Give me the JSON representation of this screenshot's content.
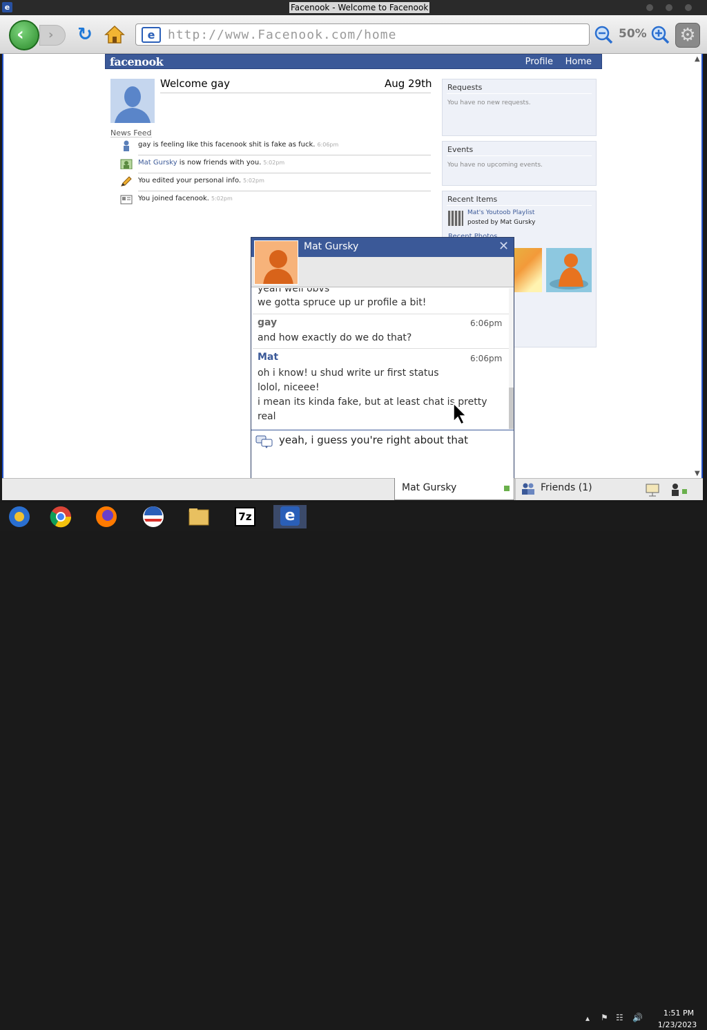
{
  "window": {
    "title": "Facenook - Welcome to Facenook"
  },
  "browser": {
    "url": "http://www.Facenook.com/home",
    "zoom": "50%"
  },
  "site": {
    "logo": "facenook",
    "nav": {
      "profile": "Profile",
      "home": "Home"
    },
    "welcome": "Welcome gay",
    "date": "Aug 29th",
    "newsfeed_label": "News Feed",
    "feed": [
      {
        "icon": "person-icon",
        "text": "gay is feeling like this facenook shit is fake as fuck.",
        "link": "",
        "time": "6:06pm"
      },
      {
        "icon": "friends-icon",
        "text": " is now friends with you.",
        "link": "Mat Gursky",
        "time": "5:02pm"
      },
      {
        "icon": "pencil-icon",
        "text": "You edited your personal info.",
        "link": "",
        "time": "5:02pm"
      },
      {
        "icon": "profile-card-icon",
        "text": "You joined facenook.",
        "link": "",
        "time": "5:02pm"
      }
    ],
    "requests": {
      "title": "Requests",
      "text": "You have no new requests."
    },
    "events": {
      "title": "Events",
      "text": "You have no upcoming events."
    },
    "recent": {
      "title": "Recent Items",
      "playlist": "Mat's Youtoob Playlist",
      "posted_by": "posted by Mat Gursky",
      "photos_label": "Recent Photos"
    }
  },
  "chat": {
    "name": "Mat Gursky",
    "messages": [
      {
        "sender": "",
        "time": "",
        "lines": [
          "yeah well obvs",
          "we gotta spruce up ur profile a bit!"
        ]
      },
      {
        "sender": "gay",
        "time": "6:06pm",
        "lines": [
          "and how exactly do we do that?"
        ]
      },
      {
        "sender": "Mat",
        "time": "6:06pm",
        "lines": [
          "oh i know! u shud write ur first status",
          "lolol, niceee!",
          "i mean its kinda fake, but at least chat is pretty",
          "real"
        ]
      }
    ],
    "input": "yeah, i guess you're right about that"
  },
  "chatbar": {
    "chat_tab": "Mat Gursky",
    "friends": "Friends (1)"
  },
  "taskbar": {
    "time": "1:51 PM",
    "date": "1/23/2023"
  },
  "colors": {
    "brand": "#3b5998",
    "online": "#6ab04c"
  }
}
